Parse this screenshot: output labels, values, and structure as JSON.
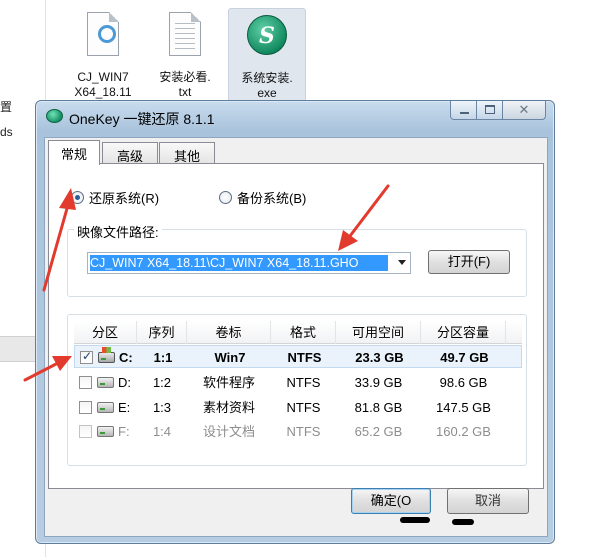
{
  "desktop": {
    "left_fragments": [
      "置",
      "ds"
    ],
    "files": [
      {
        "name": "CJ_WIN7",
        "subname": "X64_18.11",
        "icon": "iso-file-icon"
      },
      {
        "name": "安装必看.",
        "subname": "txt",
        "icon": "text-file-icon"
      },
      {
        "name": "系统安装.",
        "subname": "exe",
        "icon": "onekey-exe-icon"
      }
    ]
  },
  "window": {
    "title": "OneKey 一键还原 8.1.1",
    "icon": "onekey-app-icon",
    "tabs": [
      "常规",
      "高级",
      "其他"
    ],
    "active_tab": "常规",
    "mode_options": [
      {
        "label": "还原系统(R)",
        "selected": true
      },
      {
        "label": "备份系统(B)",
        "selected": false
      }
    ],
    "image_path_label": "映像文件路径:",
    "image_path_value": "CJ_WIN7 X64_18.11\\CJ_WIN7 X64_18.11.GHO",
    "open_button": "打开(F)",
    "partition_table": {
      "columns": [
        "分区",
        "序列",
        "卷标",
        "格式",
        "可用空间",
        "分区容量"
      ],
      "rows": [
        {
          "checked": true,
          "drive": "C:",
          "index": "1:1",
          "label": "Win7",
          "format": "NTFS",
          "free": "23.3 GB",
          "capacity": "49.7 GB",
          "system": true,
          "enabled": true
        },
        {
          "checked": false,
          "drive": "D:",
          "index": "1:2",
          "label": "软件程序",
          "format": "NTFS",
          "free": "33.9 GB",
          "capacity": "98.6 GB",
          "system": false,
          "enabled": true
        },
        {
          "checked": false,
          "drive": "E:",
          "index": "1:3",
          "label": "素材资料",
          "format": "NTFS",
          "free": "81.8 GB",
          "capacity": "147.5 GB",
          "system": false,
          "enabled": true
        },
        {
          "checked": false,
          "drive": "F:",
          "index": "1:4",
          "label": "设计文档",
          "format": "NTFS",
          "free": "65.2 GB",
          "capacity": "160.2 GB",
          "system": false,
          "enabled": false
        }
      ]
    },
    "ok_button": "确定(O",
    "cancel_button": "取消"
  },
  "colors": {
    "annotation_arrow": "#e23b2e",
    "selection_blue": "#3399ff",
    "title_bar": "#b7cde2"
  }
}
